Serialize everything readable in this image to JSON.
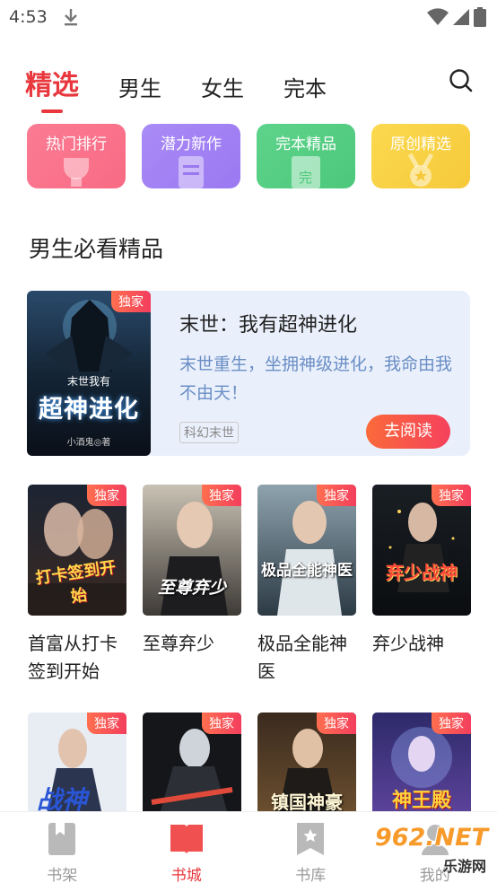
{
  "status": {
    "time": "4:53"
  },
  "tabs": [
    {
      "label": "精选",
      "active": true
    },
    {
      "label": "男生",
      "active": false
    },
    {
      "label": "女生",
      "active": false
    },
    {
      "label": "完本",
      "active": false
    }
  ],
  "categories": [
    {
      "label": "热门排行",
      "color": "#f86a84"
    },
    {
      "label": "潜力新作",
      "color": "#9b78f1"
    },
    {
      "label": "完本精品",
      "color": "#4cc87b"
    },
    {
      "label": "原创精选",
      "color": "#f6c93a"
    }
  ],
  "section_title": "男生必看精品",
  "featured": {
    "badge": "独家",
    "cover_author": "小酒鬼◎著",
    "cover_small": "末世我有",
    "cover_big": "超神进化",
    "title": "末世：我有超神进化",
    "desc": "末世重生，坐拥神级进化，我命由我不由天！",
    "tag": "科幻末世",
    "read_label": "去阅读"
  },
  "books_row1": [
    {
      "title": "首富从打卡签到开始",
      "badge": "独家",
      "cover_text": "打卡签到开始"
    },
    {
      "title": "至尊弃少",
      "badge": "独家",
      "cover_text": "至尊弃少"
    },
    {
      "title": "极品全能神医",
      "badge": "独家",
      "cover_text": "极品全能神医"
    },
    {
      "title": "弃少战神",
      "badge": "独家",
      "cover_text": "弃少战神"
    }
  ],
  "books_row2": [
    {
      "badge": "独家",
      "cover_text": "战神"
    },
    {
      "badge": "独家",
      "cover_text": ""
    },
    {
      "badge": "独家",
      "cover_text": "镇国神豪"
    },
    {
      "badge": "独家",
      "cover_text": "神王殿"
    }
  ],
  "bottom_nav": [
    {
      "label": "书架",
      "icon": "bookmark-book-icon",
      "active": false
    },
    {
      "label": "书城",
      "icon": "open-book-icon",
      "active": true
    },
    {
      "label": "书库",
      "icon": "star-book-icon",
      "active": false
    },
    {
      "label": "我的",
      "icon": "user-icon",
      "active": false
    }
  ],
  "watermark": {
    "text": "962.NET",
    "sub": "乐游网"
  },
  "colors": {
    "accent": "#e8383d",
    "card_bg": "#eaf0fb"
  }
}
